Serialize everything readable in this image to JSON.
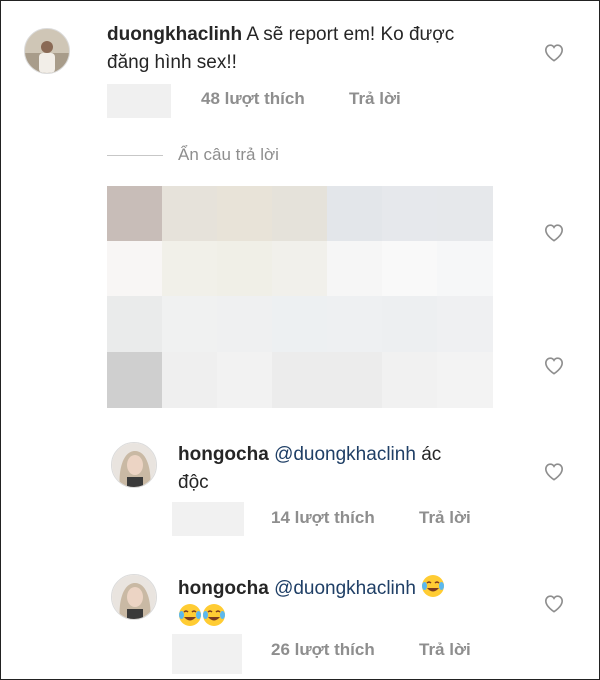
{
  "comments": [
    {
      "username": "duongkhaclinh",
      "text": "A sẽ report em! Ko được",
      "text_line2": "đăng hình sex!!",
      "likes": "48 lượt thích",
      "reply": "Trả lời"
    },
    {
      "username": "hongocha",
      "mention": "@duongkhaclinh",
      "text": "ác",
      "text_line2": "độc",
      "likes": "14 lượt thích",
      "reply": "Trả lời"
    },
    {
      "username": "hongocha",
      "mention": "@duongkhaclinh",
      "likes": "26 lượt thích",
      "reply": "Trả lời"
    }
  ],
  "hide_replies": "Ẩn câu trả lời",
  "icons": {
    "heart": "heart-icon",
    "emoji": "face-with-tears-of-joy-emoji"
  },
  "colors": {
    "muted_text": "#8e8e8e",
    "mention": "#1f3f66",
    "text": "#262626"
  }
}
